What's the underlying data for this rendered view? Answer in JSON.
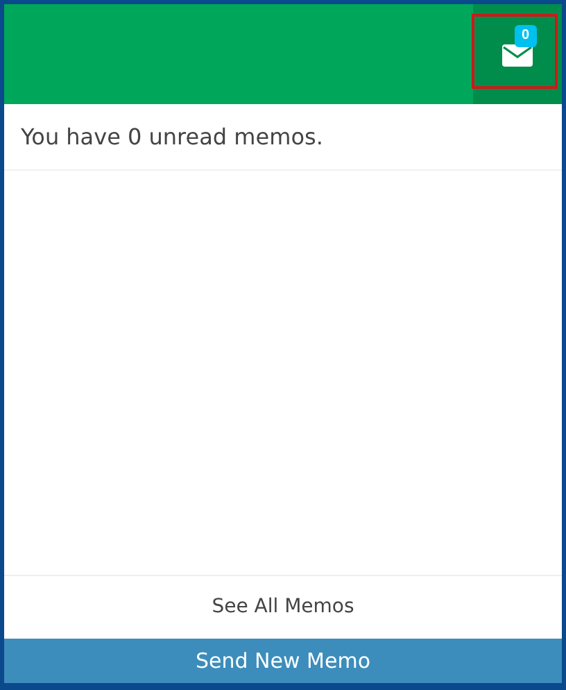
{
  "header": {
    "mail_button": {
      "badge": "0",
      "highlighted": true
    }
  },
  "message": "You have 0 unread memos.",
  "footer": {
    "link": "See All Memos",
    "button": "Send New Memo"
  }
}
